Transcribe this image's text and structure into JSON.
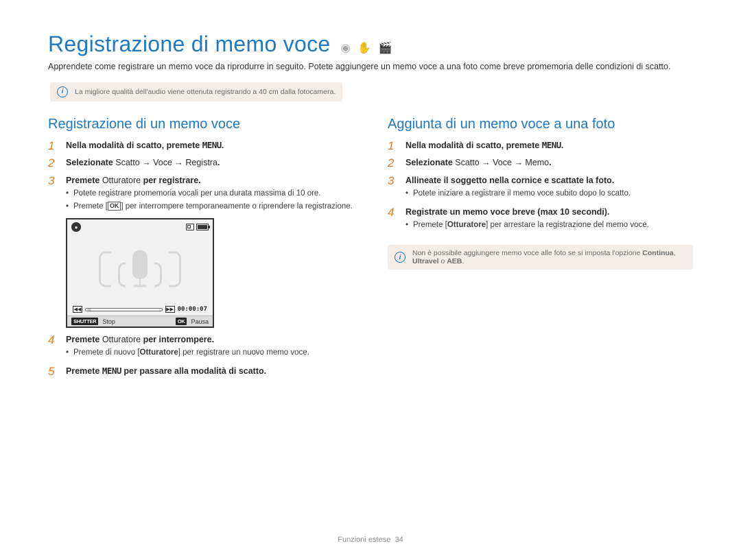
{
  "title": "Registrazione di memo voce",
  "intro": "Apprendete come registrare un memo voce da riprodurre in seguito. Potete aggiungere un memo voce a una foto come breve promemoria delle condizioni di scatto.",
  "tip_top": "La migliore qualità dell'audio viene ottenuta registrando a 40 cm dalla fotocamera.",
  "left": {
    "heading": "Registrazione di un memo voce",
    "s1_pre": "Nella modalità di scatto, premete",
    "s1_btn": "MENU",
    "s1_post": ".",
    "s2_a": "Selezionate ",
    "s2_path": "Scatto → Voce → Registra",
    "s2_end": ".",
    "s3": "Premete ",
    "s3_mid": "Otturatore",
    "s3_end": " per registrare.",
    "s3_b1": "Potete registrare promemoria vocali per una durata massima di 10 ore.",
    "s3_b2_a": "Premete [",
    "s3_b2_ok": "OK",
    "s3_b2_b": "] per interrompere temporaneamente o riprendere la registrazione.",
    "s4": "Premete ",
    "s4_mid": "Otturatore",
    "s4_end": " per interrompere.",
    "s4_b1_a": "Premete di nuovo [",
    "s4_b1_mid": "Otturatore",
    "s4_b1_b": "] per registrare un nuovo memo voce.",
    "s5_a": "Premete ",
    "s5_btn": "MENU",
    "s5_b": " per passare alla modalità di scatto."
  },
  "cam": {
    "time": "00:00:07",
    "shutter_tag": "SHUTTER",
    "stop": "Stop",
    "ok_tag": "OK",
    "pause": "Pausa"
  },
  "right": {
    "heading": "Aggiunta di un memo voce a una foto",
    "s1_pre": "Nella modalità di scatto, premete",
    "s1_btn": "MENU",
    "s1_post": ".",
    "s2_a": "Selezionate ",
    "s2_path": "Scatto → Voce → Memo",
    "s2_end": ".",
    "s3": "Allineate il soggetto nella cornice e scattate la foto.",
    "s3_b1": "Potete iniziare a registrare il memo voce subito dopo lo scatto.",
    "s4": "Registrate un memo voce breve (max 10 secondi).",
    "s4_b1_a": "Premete [",
    "s4_b1_mid": "Otturatore",
    "s4_b1_b": "] per arrestare la registrazione del memo voce.",
    "tip_a": "Non è possibile aggiungere memo voce alle foto se si imposta l'opzione ",
    "tip_b": "Continua",
    "tip_c": ", ",
    "tip_d": "Ultravel",
    "tip_e": " o ",
    "tip_f": "AEB",
    "tip_g": "."
  },
  "footer_a": "Funzioni estese",
  "footer_b": "34"
}
